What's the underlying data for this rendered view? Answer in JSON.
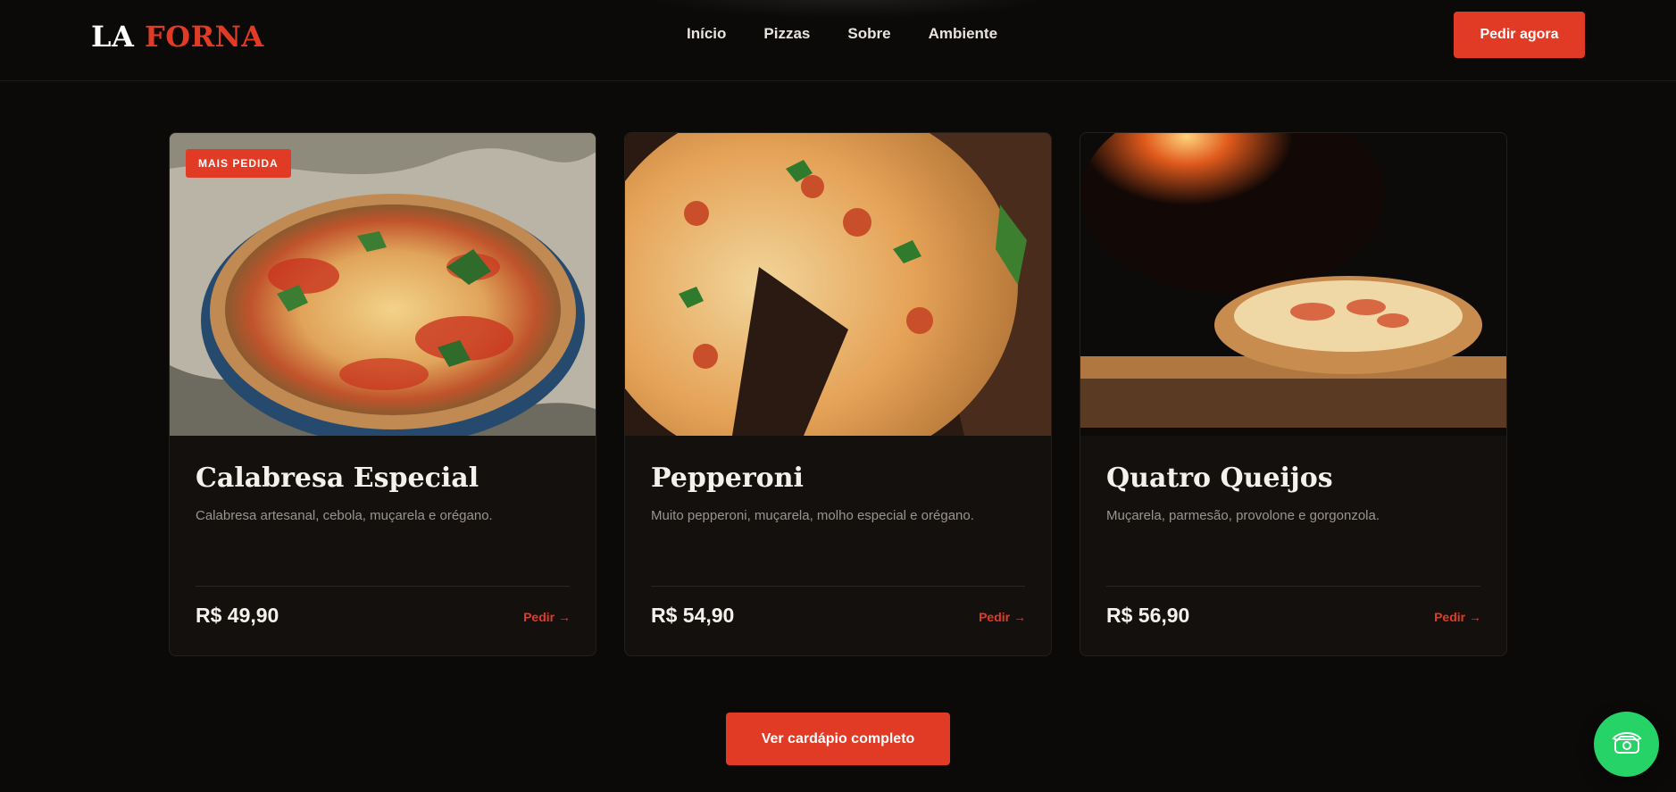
{
  "header": {
    "logo_primary": "LA",
    "logo_accent": "FORNA",
    "nav": [
      "Início",
      "Pizzas",
      "Sobre",
      "Ambiente"
    ],
    "cta_label": "Pedir agora"
  },
  "cards": [
    {
      "badge": "MAIS PEDIDA",
      "title": "Calabresa Especial",
      "description": "Calabresa artesanal, cebola, muçarela e orégano.",
      "price": "R$ 49,90",
      "order_label": "Pedir →"
    },
    {
      "title": "Pepperoni",
      "description": "Muito pepperoni, muçarela, molho especial e orégano.",
      "price": "R$ 54,90",
      "order_label": "Pedir →"
    },
    {
      "title": "Quatro Queijos",
      "description": "Muçarela, parmesão, provolone e gorgonzola.",
      "price": "R$ 56,90",
      "order_label": "Pedir →"
    }
  ],
  "menu_cta_label": "Ver cardápio completo",
  "floating": {
    "icon": "whatsapp-phone-icon"
  },
  "colors": {
    "accent": "#e23b25",
    "background": "#0b0a09",
    "card": "#13100e",
    "whatsapp": "#25d366"
  }
}
